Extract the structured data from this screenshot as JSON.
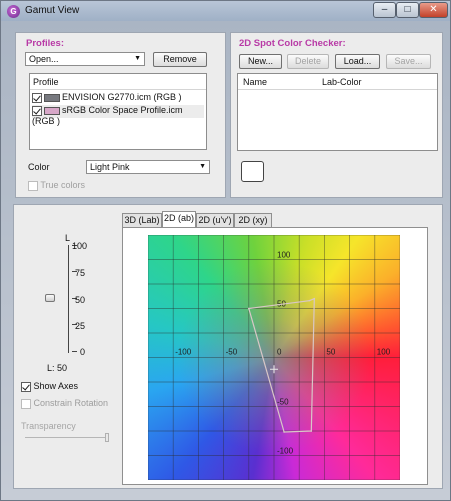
{
  "window": {
    "title": "Gamut View",
    "icon": "app-icon"
  },
  "titlebar": {
    "minimize": "–",
    "maximize": "□",
    "close": "✕"
  },
  "profiles": {
    "label": "Profiles:",
    "dropdown_value": "Open...",
    "remove_label": "Remove",
    "list_header": "Profile",
    "items": [
      {
        "name": "ENVISION G2770.icm (RGB )",
        "checked": true,
        "swatch": "#77797f"
      },
      {
        "name": "sRGB Color Space Profile.icm (RGB )",
        "checked": true,
        "swatch": "#d7a7c8"
      }
    ],
    "color_label": "Color",
    "color_value": "Light Pink",
    "true_colors_label": "True colors"
  },
  "spot_checker": {
    "label": "2D Spot Color Checker:",
    "buttons": {
      "new": "New...",
      "delete": "Delete",
      "load": "Load...",
      "save": "Save..."
    },
    "columns": {
      "name": "Name",
      "lab": "Lab-Color"
    }
  },
  "controls": {
    "l_label": "L",
    "ticks": [
      "100",
      "75",
      "50",
      "25",
      "0"
    ],
    "l_value_text": "L: 50",
    "l_value": 50,
    "show_axes_label": "Show Axes",
    "constrain_label": "Constrain Rotation",
    "transparency_label": "Transparency"
  },
  "tabs": [
    "3D (Lab)",
    "2D (ab)",
    "2D (u'v')",
    "2D (xy)"
  ],
  "active_tab": 1,
  "chart_data": {
    "type": "line",
    "title": "",
    "xlim": [
      -125,
      125
    ],
    "ylim": [
      -125,
      125
    ],
    "grid": true,
    "axis_labels": {
      "x": [
        "-100",
        "-50",
        "50",
        "100"
      ],
      "y": [
        "100",
        "50",
        "-50",
        "-100"
      ],
      "origin": "0"
    },
    "series": [
      {
        "color": "#d9c7c7",
        "x": [
          -25,
          35,
          40,
          37,
          10,
          -25
        ],
        "y": [
          50,
          58,
          60,
          -75,
          -76,
          50
        ]
      }
    ]
  }
}
